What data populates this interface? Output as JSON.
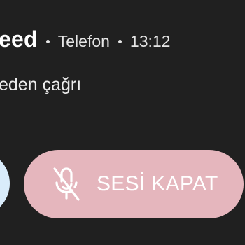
{
  "notification": {
    "caller_name": "eed",
    "app_name": "Telefon",
    "time": "13:12",
    "status_text": "eden çağrı"
  },
  "actions": {
    "mute_label": "SESİ KAPAT",
    "mute_icon": "mic-off-icon",
    "mute_color": "#e5b6bd",
    "secondary_color": "#d9ecfb"
  },
  "theme": {
    "background": "#202020",
    "text": "#ffffff"
  }
}
